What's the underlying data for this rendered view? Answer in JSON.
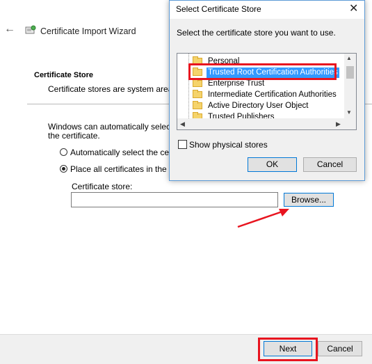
{
  "wizard": {
    "title": "Certificate Import Wizard",
    "section_title": "Certificate Store",
    "section_subtitle": "Certificate stores are system areas w",
    "description_line1": "Windows can automatically select a c",
    "description_line2": "the certificate.",
    "radio_auto_label": "Automatically select the certifi",
    "radio_place_label": "Place all certificates in the follo",
    "store_label": "Certificate store:",
    "store_value": "",
    "browse_label": "Browse...",
    "next_label": "Next",
    "cancel_label": "Cancel"
  },
  "dialog": {
    "title": "Select Certificate Store",
    "close_glyph": "✕",
    "prompt": "Select the certificate store you want to use.",
    "tree_items": [
      {
        "label": "Personal",
        "selected": false
      },
      {
        "label": "Trusted Root Certification Authorities",
        "selected": true
      },
      {
        "label": "Enterprise Trust",
        "selected": false
      },
      {
        "label": "Intermediate Certification Authorities",
        "selected": false
      },
      {
        "label": "Active Directory User Object",
        "selected": false
      },
      {
        "label": "Trusted Publishers",
        "selected": false
      }
    ],
    "show_physical_label": "Show physical stores",
    "ok_label": "OK",
    "cancel_label": "Cancel"
  },
  "colors": {
    "highlight_red": "#e8141f",
    "selection_blue": "#3399ff",
    "focus_blue": "#0078d7"
  }
}
